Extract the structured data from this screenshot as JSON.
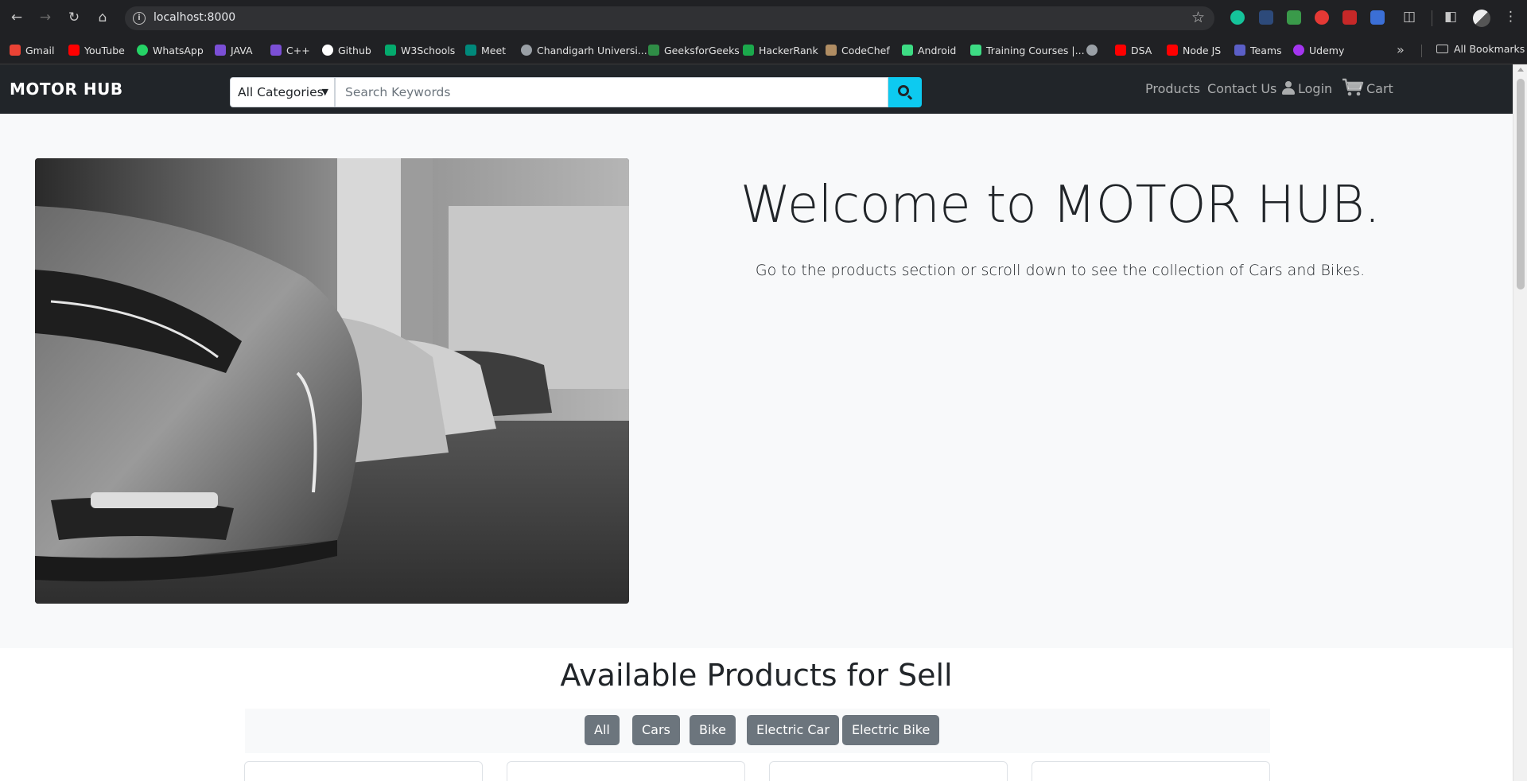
{
  "browser": {
    "url": "localhost:8000",
    "bookmarks": [
      {
        "label": "Gmail",
        "icon": "gmail-icon",
        "color": "#ea4335"
      },
      {
        "label": "YouTube",
        "icon": "youtube-icon",
        "color": "#ff0000"
      },
      {
        "label": "WhatsApp",
        "icon": "whatsapp-icon",
        "color": "#25d366"
      },
      {
        "label": "JAVA",
        "icon": "bolt-icon",
        "color": "#7b4fd6"
      },
      {
        "label": "C++",
        "icon": "bolt-icon",
        "color": "#7b4fd6"
      },
      {
        "label": "Github",
        "icon": "github-icon",
        "color": "#ffffff"
      },
      {
        "label": "W3Schools",
        "icon": "w3schools-icon",
        "color": "#04aa6d"
      },
      {
        "label": "Meet",
        "icon": "meet-icon",
        "color": "#00897b"
      },
      {
        "label": "Chandigarh Universi...",
        "icon": "globe-icon",
        "color": "#9aa0a6"
      },
      {
        "label": "GeeksforGeeks",
        "icon": "gfg-icon",
        "color": "#2f8d46"
      },
      {
        "label": "HackerRank",
        "icon": "hackerrank-icon",
        "color": "#1ba94c"
      },
      {
        "label": "CodeChef",
        "icon": "codechef-icon",
        "color": "#b08d63"
      },
      {
        "label": "Android",
        "icon": "android-icon",
        "color": "#3ddc84"
      },
      {
        "label": "Training Courses |...",
        "icon": "android-icon",
        "color": "#3ddc84"
      },
      {
        "label": "",
        "icon": "globe-icon",
        "color": "#9aa0a6"
      },
      {
        "label": "DSA",
        "icon": "youtube-icon",
        "color": "#ff0000"
      },
      {
        "label": "Node JS",
        "icon": "youtube-icon",
        "color": "#ff0000"
      },
      {
        "label": "Teams",
        "icon": "teams-icon",
        "color": "#5b5fc7"
      },
      {
        "label": "Udemy",
        "icon": "udemy-icon",
        "color": "#a435f0"
      }
    ],
    "all_bookmarks": "All Bookmarks"
  },
  "navbar": {
    "brand": "MOTOR HUB",
    "category_select": "All Categories",
    "search_placeholder": "Search Keywords",
    "links": {
      "products": "Products",
      "contact": "Contact Us",
      "login": "Login",
      "cart": "Cart"
    },
    "accent": "#0dcaf0"
  },
  "hero": {
    "title": "Welcome to MOTOR HUB.",
    "lead": "Go to the products section or scroll down to see the collection of Cars and Bikes."
  },
  "products": {
    "title": "Available Products for Sell",
    "filters": [
      "All",
      "Cars",
      "Bike",
      "Electric Car",
      "Electric Bike"
    ]
  }
}
